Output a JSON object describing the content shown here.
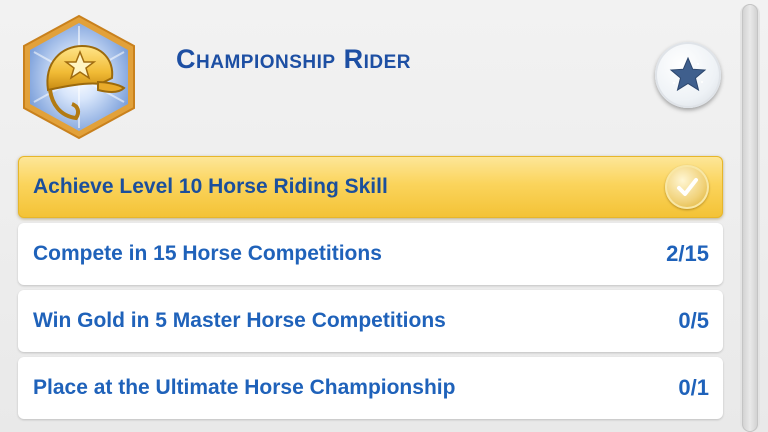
{
  "aspiration": {
    "title": "Championship Rider",
    "badge_icon": "riding-helmet-icon",
    "reward_icon": "star-icon"
  },
  "goals": [
    {
      "label": "Achieve Level 10 Horse Riding Skill",
      "progress": "",
      "completed": true,
      "status_icon": "checkmark-icon"
    },
    {
      "label": "Compete in 15 Horse Competitions",
      "progress": "2/15",
      "completed": false
    },
    {
      "label": "Win Gold in 5 Master Horse Competitions",
      "progress": "0/5",
      "completed": false
    },
    {
      "label": "Place at the Ultimate Horse Championship",
      "progress": "0/1",
      "completed": false
    }
  ],
  "colors": {
    "title": "#1d4fa3",
    "goal_text": "#1f62ba",
    "completed_gold": "#fbd45c",
    "badge_blue": "#7fa6e0",
    "badge_border": "#e2a13a"
  }
}
